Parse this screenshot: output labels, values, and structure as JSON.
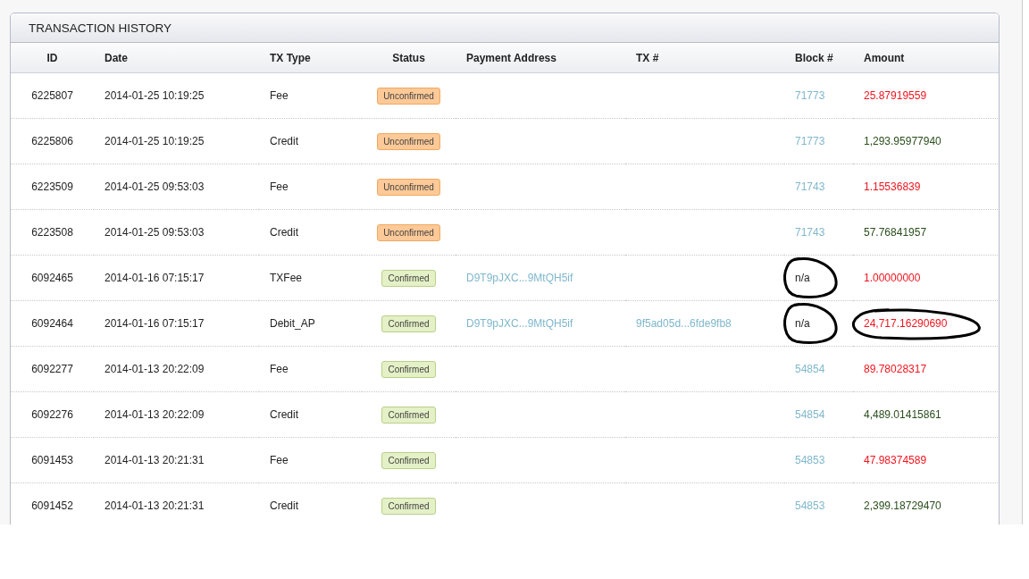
{
  "panel": {
    "title": "TRANSACTION HISTORY"
  },
  "table": {
    "columns": [
      "ID",
      "Date",
      "TX Type",
      "Status",
      "Payment Address",
      "TX #",
      "Block #",
      "Amount"
    ],
    "rows": [
      {
        "id": "6225807",
        "date": "2014-01-25 10:19:25",
        "tx_type": "Fee",
        "status": {
          "label": "Unconfirmed",
          "kind": "unconfirmed"
        },
        "block": {
          "value": "71773",
          "kind": "link",
          "circled": false
        },
        "amount": {
          "value": "25.87919559",
          "kind": "debit",
          "circled": false
        }
      },
      {
        "id": "6225806",
        "date": "2014-01-25 10:19:25",
        "tx_type": "Credit",
        "status": {
          "label": "Unconfirmed",
          "kind": "unconfirmed"
        },
        "block": {
          "value": "71773",
          "kind": "link",
          "circled": false
        },
        "amount": {
          "value": "1,293.95977940",
          "kind": "credit",
          "circled": false
        }
      },
      {
        "id": "6223509",
        "date": "2014-01-25 09:53:03",
        "tx_type": "Fee",
        "status": {
          "label": "Unconfirmed",
          "kind": "unconfirmed"
        },
        "block": {
          "value": "71743",
          "kind": "link",
          "circled": false
        },
        "amount": {
          "value": "1.15536839",
          "kind": "debit",
          "circled": false
        }
      },
      {
        "id": "6223508",
        "date": "2014-01-25 09:53:03",
        "tx_type": "Credit",
        "status": {
          "label": "Unconfirmed",
          "kind": "unconfirmed"
        },
        "block": {
          "value": "71743",
          "kind": "link",
          "circled": false
        },
        "amount": {
          "value": "57.76841957",
          "kind": "credit",
          "circled": false
        }
      },
      {
        "id": "6092465",
        "date": "2014-01-16 07:15:17",
        "tx_type": "TXFee",
        "status": {
          "label": "Confirmed",
          "kind": "confirmed"
        },
        "payment_address": "D9T9pJXC...9MtQH5if",
        "block": {
          "value": "n/a",
          "kind": "plain",
          "circled": true
        },
        "amount": {
          "value": "1.00000000",
          "kind": "debit",
          "circled": false
        }
      },
      {
        "id": "6092464",
        "date": "2014-01-16 07:15:17",
        "tx_type": "Debit_AP",
        "status": {
          "label": "Confirmed",
          "kind": "confirmed"
        },
        "payment_address": "D9T9pJXC...9MtQH5if",
        "tx": "9f5ad05d...6fde9fb8",
        "block": {
          "value": "n/a",
          "kind": "plain",
          "circled": true
        },
        "amount": {
          "value": "24,717.16290690",
          "kind": "debit",
          "circled": true
        }
      },
      {
        "id": "6092277",
        "date": "2014-01-13 20:22:09",
        "tx_type": "Fee",
        "status": {
          "label": "Confirmed",
          "kind": "confirmed"
        },
        "block": {
          "value": "54854",
          "kind": "link",
          "circled": false
        },
        "amount": {
          "value": "89.78028317",
          "kind": "debit",
          "circled": false
        }
      },
      {
        "id": "6092276",
        "date": "2014-01-13 20:22:09",
        "tx_type": "Credit",
        "status": {
          "label": "Confirmed",
          "kind": "confirmed"
        },
        "block": {
          "value": "54854",
          "kind": "link",
          "circled": false
        },
        "amount": {
          "value": "4,489.01415861",
          "kind": "credit",
          "circled": false
        }
      },
      {
        "id": "6091453",
        "date": "2014-01-13 20:21:31",
        "tx_type": "Fee",
        "status": {
          "label": "Confirmed",
          "kind": "confirmed"
        },
        "block": {
          "value": "54853",
          "kind": "link",
          "circled": false
        },
        "amount": {
          "value": "47.98374589",
          "kind": "debit",
          "circled": false
        }
      },
      {
        "id": "6091452",
        "date": "2014-01-13 20:21:31",
        "tx_type": "Credit",
        "status": {
          "label": "Confirmed",
          "kind": "confirmed"
        },
        "block": {
          "value": "54853",
          "kind": "link",
          "circled": false
        },
        "amount": {
          "value": "2,399.18729470",
          "kind": "credit",
          "circled": false
        }
      }
    ]
  }
}
